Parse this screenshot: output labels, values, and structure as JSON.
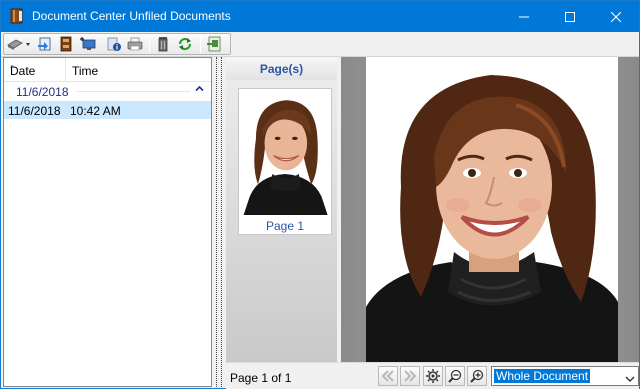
{
  "window": {
    "title": "Document Center Unfiled Documents",
    "accent_color": "#0078d7",
    "icon": "book-app-icon"
  },
  "window_controls": {
    "minimize_icon": "minimize-icon",
    "maximize_icon": "maximize-icon",
    "close_icon": "close-icon"
  },
  "toolbar": {
    "items": [
      {
        "name": "scan-dropdown-button",
        "icon": "scanner-icon"
      },
      {
        "name": "import-button",
        "icon": "import-icon"
      },
      {
        "name": "file-button",
        "icon": "file-cabinet-icon"
      },
      {
        "name": "new-button",
        "icon": "monitor-add-icon"
      },
      {
        "name": "properties-button",
        "icon": "document-info-icon"
      },
      {
        "name": "print-button",
        "icon": "printer-icon"
      },
      {
        "name": "delete-button",
        "icon": "trash-icon"
      },
      {
        "name": "refresh-button",
        "icon": "refresh-icon"
      },
      {
        "name": "export-button",
        "icon": "export-icon"
      }
    ]
  },
  "list": {
    "columns": [
      "Date",
      "Time"
    ],
    "groups": [
      {
        "label": "11/6/2018",
        "rows": [
          {
            "date": "11/6/2018",
            "time": "10:42 AM",
            "selected": true
          }
        ]
      }
    ],
    "selection_color": "#cce8ff"
  },
  "thumbnails": {
    "header": "Page(s)",
    "items": [
      {
        "caption": "Page 1"
      }
    ]
  },
  "status": {
    "page_text": "Page 1 of 1",
    "zoom_selected": "Whole Document"
  }
}
